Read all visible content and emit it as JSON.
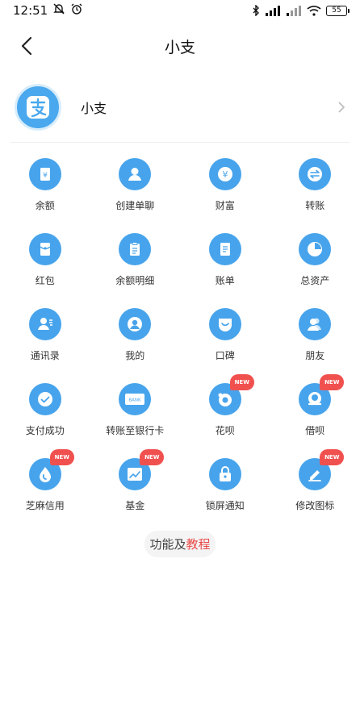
{
  "status_bar": {
    "time": "12:51",
    "battery": "55"
  },
  "nav": {
    "title": "小支"
  },
  "profile": {
    "name": "小支"
  },
  "tiles": [
    {
      "label": "余额",
      "icon": "wallet-icon",
      "badge": ""
    },
    {
      "label": "创建单聊",
      "icon": "person-icon",
      "badge": ""
    },
    {
      "label": "财富",
      "icon": "yuan-icon",
      "badge": ""
    },
    {
      "label": "转账",
      "icon": "transfer-icon",
      "badge": ""
    },
    {
      "label": "红包",
      "icon": "red-packet-icon",
      "badge": ""
    },
    {
      "label": "余额明细",
      "icon": "clipboard-icon",
      "badge": ""
    },
    {
      "label": "账单",
      "icon": "bill-icon",
      "badge": ""
    },
    {
      "label": "总资产",
      "icon": "pie-chart-icon",
      "badge": ""
    },
    {
      "label": "通讯录",
      "icon": "contacts-icon",
      "badge": ""
    },
    {
      "label": "我的",
      "icon": "profile-icon",
      "badge": ""
    },
    {
      "label": "口碑",
      "icon": "smile-bag-icon",
      "badge": ""
    },
    {
      "label": "朋友",
      "icon": "friends-icon",
      "badge": ""
    },
    {
      "label": "支付成功",
      "icon": "check-icon",
      "badge": ""
    },
    {
      "label": "转账至银行卡",
      "icon": "bank-card-icon",
      "badge": "",
      "card_text": "BANK"
    },
    {
      "label": "花呗",
      "icon": "huabei-icon",
      "badge": "NEW"
    },
    {
      "label": "借呗",
      "icon": "jiebei-icon",
      "badge": "NEW"
    },
    {
      "label": "芝麻信用",
      "icon": "sesame-drop-icon",
      "badge": "NEW"
    },
    {
      "label": "基金",
      "icon": "fund-chart-icon",
      "badge": "NEW"
    },
    {
      "label": "锁屏通知",
      "icon": "lock-icon",
      "badge": ""
    },
    {
      "label": "修改图标",
      "icon": "edit-icon",
      "badge": "NEW"
    }
  ],
  "tutorial": {
    "prefix": "功能及",
    "accent": "教程"
  },
  "colors": {
    "icon_blue": "#47a4ec",
    "badge_red": "#f0514f",
    "accent_red": "#e94a48"
  }
}
